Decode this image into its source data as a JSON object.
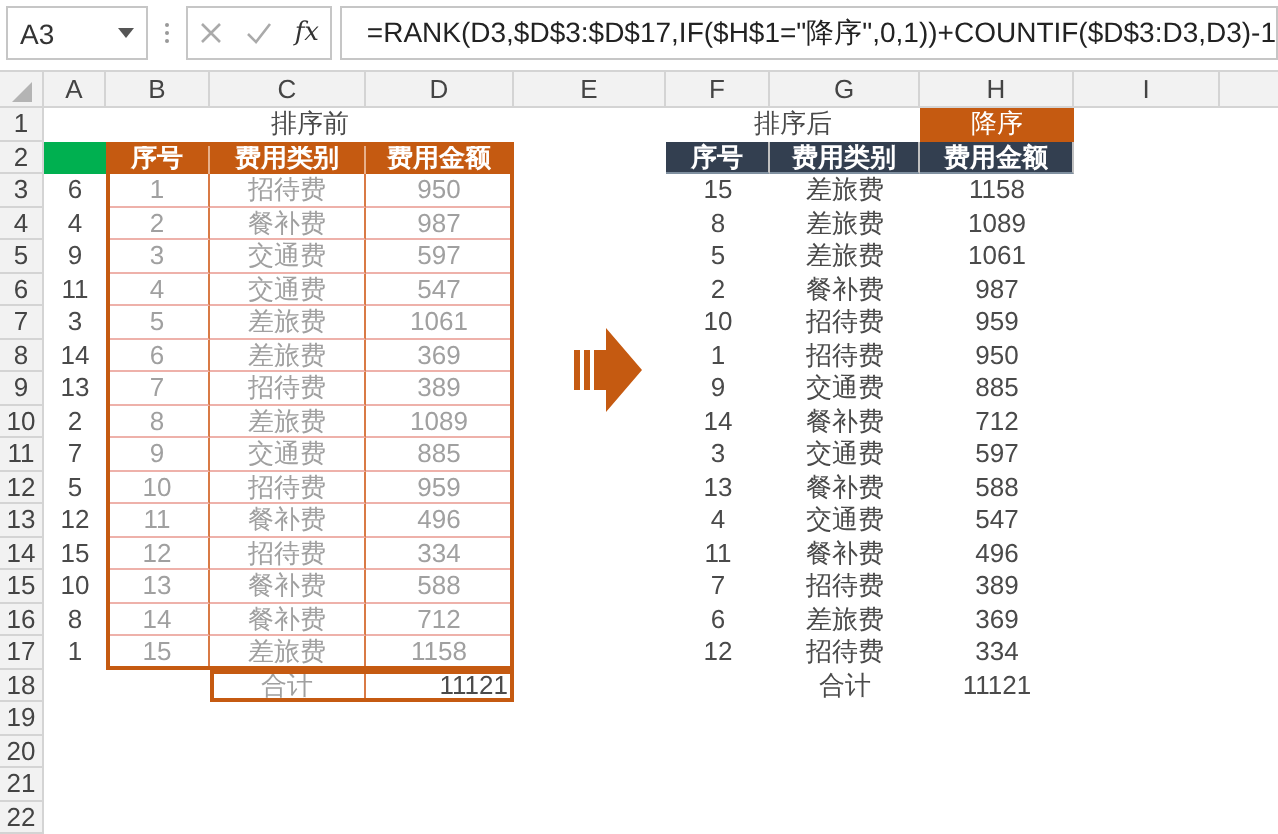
{
  "name_box": "A3",
  "fx_label": "fx",
  "formula": "=RANK(D3,$D$3:$D$17,IF($H$1=\"降序\",0,1))+COUNTIF($D$3:D3,D3)-1",
  "columns": [
    "A",
    "B",
    "C",
    "D",
    "E",
    "F",
    "G",
    "H",
    "I"
  ],
  "row_numbers": [
    "1",
    "2",
    "3",
    "4",
    "5",
    "6",
    "7",
    "8",
    "9",
    "10",
    "11",
    "12",
    "13",
    "14",
    "15",
    "16",
    "17",
    "18",
    "19",
    "20",
    "21",
    "22"
  ],
  "left_table": {
    "title": "排序前",
    "headers": [
      "序号",
      "费用类别",
      "费用金额"
    ],
    "rows": [
      {
        "rank": "6",
        "no": "1",
        "category": "招待费",
        "amount": "950"
      },
      {
        "rank": "4",
        "no": "2",
        "category": "餐补费",
        "amount": "987"
      },
      {
        "rank": "9",
        "no": "3",
        "category": "交通费",
        "amount": "597"
      },
      {
        "rank": "11",
        "no": "4",
        "category": "交通费",
        "amount": "547"
      },
      {
        "rank": "3",
        "no": "5",
        "category": "差旅费",
        "amount": "1061"
      },
      {
        "rank": "14",
        "no": "6",
        "category": "差旅费",
        "amount": "369"
      },
      {
        "rank": "13",
        "no": "7",
        "category": "招待费",
        "amount": "389"
      },
      {
        "rank": "2",
        "no": "8",
        "category": "差旅费",
        "amount": "1089"
      },
      {
        "rank": "7",
        "no": "9",
        "category": "交通费",
        "amount": "885"
      },
      {
        "rank": "5",
        "no": "10",
        "category": "招待费",
        "amount": "959"
      },
      {
        "rank": "12",
        "no": "11",
        "category": "餐补费",
        "amount": "496"
      },
      {
        "rank": "15",
        "no": "12",
        "category": "招待费",
        "amount": "334"
      },
      {
        "rank": "10",
        "no": "13",
        "category": "餐补费",
        "amount": "588"
      },
      {
        "rank": "8",
        "no": "14",
        "category": "餐补费",
        "amount": "712"
      },
      {
        "rank": "1",
        "no": "15",
        "category": "差旅费",
        "amount": "1158"
      }
    ],
    "total_label": "合计",
    "total": "11121"
  },
  "right_table": {
    "title": "排序后",
    "order": "降序",
    "headers": [
      "序号",
      "费用类别",
      "费用金额"
    ],
    "rows": [
      {
        "no": "15",
        "category": "差旅费",
        "amount": "1158"
      },
      {
        "no": "8",
        "category": "差旅费",
        "amount": "1089"
      },
      {
        "no": "5",
        "category": "差旅费",
        "amount": "1061"
      },
      {
        "no": "2",
        "category": "餐补费",
        "amount": "987"
      },
      {
        "no": "10",
        "category": "招待费",
        "amount": "959"
      },
      {
        "no": "1",
        "category": "招待费",
        "amount": "950"
      },
      {
        "no": "9",
        "category": "交通费",
        "amount": "885"
      },
      {
        "no": "14",
        "category": "餐补费",
        "amount": "712"
      },
      {
        "no": "3",
        "category": "交通费",
        "amount": "597"
      },
      {
        "no": "13",
        "category": "餐补费",
        "amount": "588"
      },
      {
        "no": "4",
        "category": "交通费",
        "amount": "547"
      },
      {
        "no": "11",
        "category": "餐补费",
        "amount": "496"
      },
      {
        "no": "7",
        "category": "招待费",
        "amount": "389"
      },
      {
        "no": "6",
        "category": "差旅费",
        "amount": "369"
      },
      {
        "no": "12",
        "category": "招待费",
        "amount": "334"
      }
    ],
    "total_label": "合计",
    "total": "11121"
  }
}
